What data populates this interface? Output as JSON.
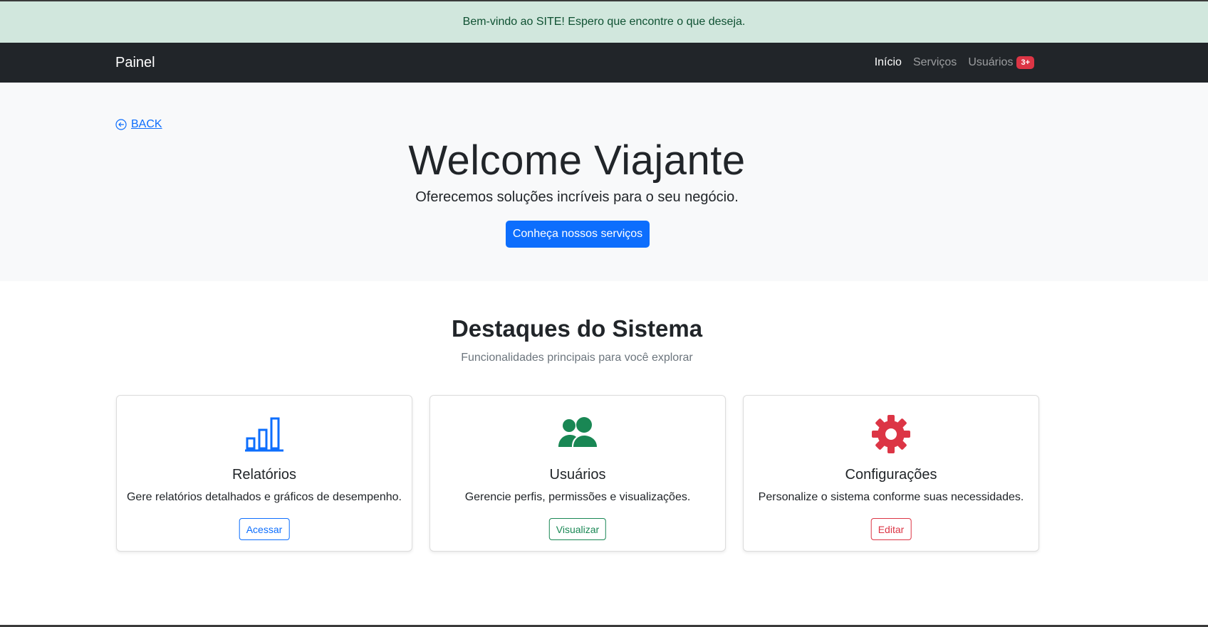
{
  "alert": {
    "text": "Bem-vindo ao SITE! Espero que encontre o que deseja."
  },
  "navbar": {
    "brand": "Painel",
    "links": [
      {
        "label": "Início",
        "active": true
      },
      {
        "label": "Serviços",
        "active": false
      },
      {
        "label": "Usuários",
        "active": false,
        "badge": "3+"
      }
    ]
  },
  "hero": {
    "back_label": "BACK",
    "title": "Welcome Viajante",
    "subtitle": "Oferecemos soluções incríveis para o seu negócio.",
    "cta_label": "Conheça nossos serviços"
  },
  "features": {
    "title": "Destaques do Sistema",
    "subtitle": "Funcionalidades principais para você explorar",
    "cards": [
      {
        "icon": "bar-chart-icon",
        "color": "#0d6efd",
        "title": "Relatórios",
        "text": "Gere relatórios detalhados e gráficos de desempenho.",
        "button": "Acessar"
      },
      {
        "icon": "people-icon",
        "color": "#198754",
        "title": "Usuários",
        "text": "Gerencie perfis, permissões e visualizações.",
        "button": "Visualizar"
      },
      {
        "icon": "gear-icon",
        "color": "#dc3545",
        "title": "Configurações",
        "text": "Personalize o sistema conforme suas necessidades.",
        "button": "Editar"
      }
    ]
  },
  "colors": {
    "primary": "#0d6efd",
    "success": "#198754",
    "danger": "#dc3545",
    "dark": "#212529",
    "alert_bg": "#d1e7dd"
  }
}
